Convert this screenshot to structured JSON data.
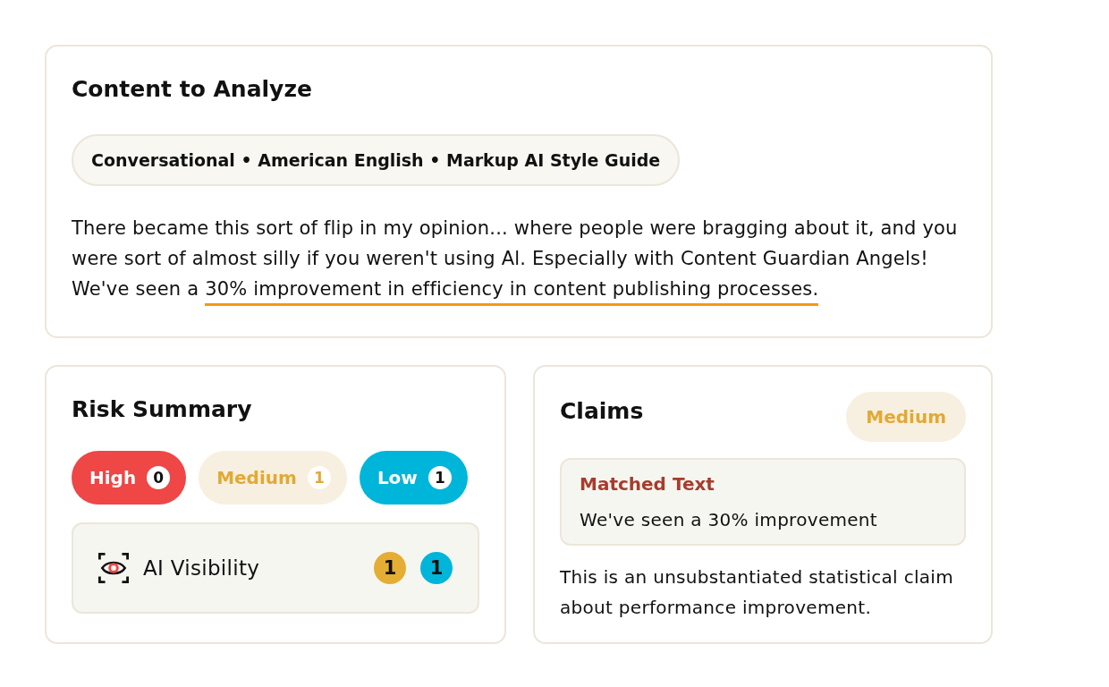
{
  "content_card": {
    "title": "Content to Analyze",
    "settings_chip": "Conversational • American English • Markup AI Style Guide",
    "paragraph": [
      {
        "text": "There became this sort of flip in my opinion... where people were bragging about it, and you were sort of almost silly if you weren't using Al. Especially with Content Guardian Angels! We've seen a ",
        "highlighted": false
      },
      {
        "text": "30% improvement in efficiency in content publishing processes.",
        "highlighted": true
      }
    ]
  },
  "risk_summary": {
    "title": "Risk Summary",
    "levels": [
      {
        "label": "High",
        "count": "0",
        "kind": "high"
      },
      {
        "label": "Medium",
        "count": "1",
        "kind": "medium"
      },
      {
        "label": "Low",
        "count": "1",
        "kind": "low"
      }
    ],
    "categories": [
      {
        "label": "AI Visibility",
        "counts": [
          {
            "value": "1",
            "kind": "medium"
          },
          {
            "value": "1",
            "kind": "low"
          }
        ]
      }
    ]
  },
  "claims": {
    "title": "Claims",
    "severity": {
      "label": "Medium",
      "kind": "medium"
    },
    "matched": {
      "label": "Matched Text",
      "text": "We've seen a 30% improvement"
    },
    "description": "This is an unsubstantiated statistical claim about performance improvement."
  }
}
